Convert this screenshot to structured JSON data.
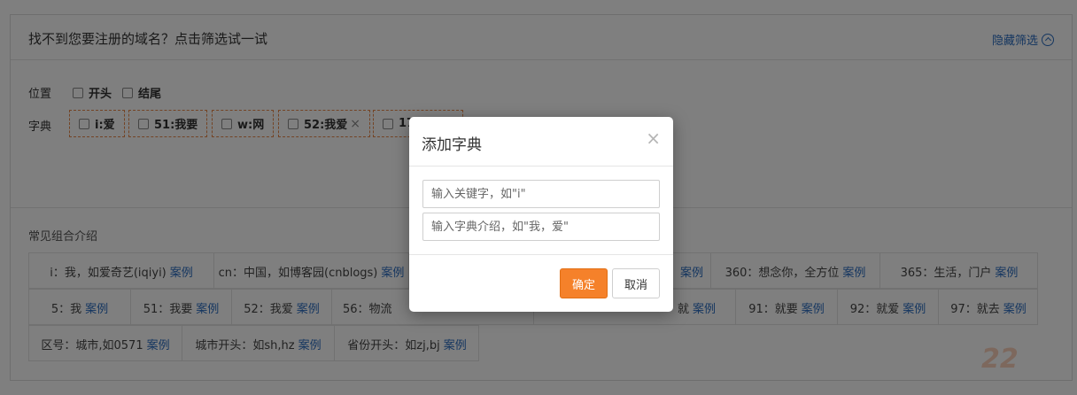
{
  "header": {
    "title": "找不到您要注册的域名？点击筛选试一试",
    "toggle_label": "隐藏筛选",
    "toggle_icon": "chevron-up-circle-icon"
  },
  "position": {
    "label": "位置",
    "options": [
      "开头",
      "结尾"
    ]
  },
  "dictionary": {
    "label": "字典",
    "tags": [
      {
        "text": "i:爱",
        "closable": false
      },
      {
        "text": "51:我要",
        "closable": false
      },
      {
        "text": "w:网",
        "closable": false
      },
      {
        "text": "52:我爱",
        "closable": true
      },
      {
        "text": "17",
        "closable": false
      }
    ],
    "close_glyph": "×"
  },
  "combos": {
    "title": "常见组合介绍",
    "link_label": "案例",
    "row1": [
      "i：我，如爱奇艺(iqiyi)",
      "cn：中国，如博客园(cnblogs)",
      "",
      "360：想念你，全方位",
      "365：生活，门户"
    ],
    "row2": [
      "5：我",
      "51：我要",
      "52：我爱",
      "56：物流",
      "",
      "就",
      "91：就要",
      "92：就爱",
      "97：就去"
    ],
    "row3": [
      "区号：城市,如0571",
      "城市开头：如sh,hz",
      "省份开头：如zj,bj"
    ]
  },
  "modal": {
    "title": "添加字典",
    "close_glyph": "×",
    "keyword_placeholder": "输入关键字，如\"i\"",
    "intro_placeholder": "输入字典介绍，如\"我，爱\"",
    "ok_label": "确定",
    "cancel_label": "取消"
  },
  "watermark": "22",
  "colors": {
    "accent": "#f5812a",
    "link": "#2a6cc0",
    "tag_border": "#e8894a"
  }
}
